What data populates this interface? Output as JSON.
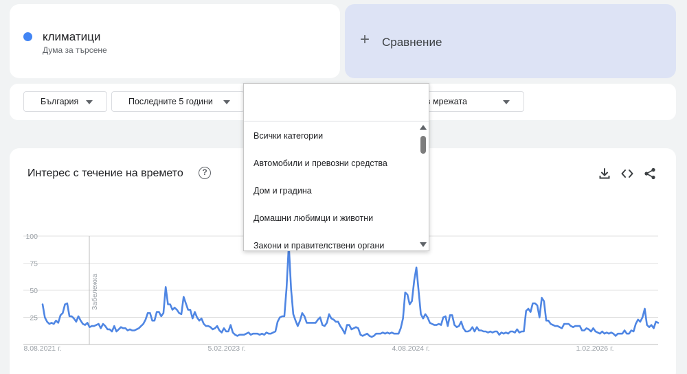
{
  "search_term": {
    "name": "климатици",
    "subtitle": "Дума за търсене",
    "color": "#4285f4"
  },
  "compare": {
    "label": "Сравнение"
  },
  "filters": {
    "region": "България",
    "period": "Последните 5 години",
    "search_type": "Търсене в мрежата"
  },
  "main": {
    "title": "Интерес с течение на времето",
    "help_icon": "help-circle-icon",
    "tools": [
      "download-icon",
      "embed-code-icon",
      "share-icon"
    ]
  },
  "category_dropdown": {
    "search_value": "",
    "items": [
      "Всички категории",
      "Автомобили и превозни средства",
      "Дом и градина",
      "Домашни любимци и животни",
      "Закони и правителствени органи"
    ]
  },
  "chart_data": {
    "type": "line",
    "ylim": [
      0,
      100
    ],
    "yticks": [
      "100",
      "75",
      "50",
      "25"
    ],
    "xtick_labels": [
      "8.08.2021 г.",
      "5.02.2023 г.",
      "4.08.2024 г.",
      "1.02.2026 г."
    ],
    "note_label": "Забележка",
    "series": [
      {
        "color": "#4f86e3",
        "values": [
          37,
          25,
          21,
          19,
          20,
          19,
          22,
          20,
          27,
          29,
          37,
          38,
          26,
          26,
          24,
          21,
          26,
          22,
          19,
          18,
          20,
          16,
          17,
          17,
          18,
          19,
          15,
          19,
          17,
          14,
          14,
          12,
          17,
          12,
          14,
          16,
          15,
          15,
          13,
          14,
          13,
          13,
          14,
          15,
          17,
          19,
          23,
          29,
          29,
          22,
          22,
          30,
          30,
          26,
          29,
          53,
          37,
          37,
          32,
          34,
          32,
          29,
          28,
          44,
          38,
          32,
          32,
          24,
          30,
          25,
          22,
          24,
          19,
          17,
          17,
          16,
          14,
          15,
          17,
          13,
          11,
          15,
          12,
          12,
          18,
          11,
          9,
          8,
          9,
          9,
          9,
          10,
          11,
          9,
          10,
          10,
          10,
          9,
          10,
          9,
          11,
          10,
          10,
          11,
          12,
          21,
          25,
          26,
          26,
          52,
          92,
          51,
          28,
          22,
          17,
          22,
          29,
          26,
          20,
          20,
          20,
          20,
          20,
          23,
          25,
          18,
          17,
          20,
          28,
          24,
          23,
          21,
          21,
          17,
          14,
          10,
          18,
          18,
          14,
          15,
          16,
          15,
          9,
          8,
          9,
          10,
          8,
          7,
          8,
          10,
          10,
          10,
          11,
          10,
          11,
          10,
          11,
          10,
          10,
          10,
          15,
          24,
          48,
          46,
          37,
          40,
          59,
          71,
          49,
          28,
          24,
          28,
          25,
          20,
          19,
          18,
          18,
          19,
          18,
          25,
          26,
          17,
          27,
          27,
          18,
          16,
          17,
          21,
          15,
          12,
          12,
          13,
          16,
          12,
          16,
          13,
          13,
          12,
          12,
          11,
          12,
          11,
          12,
          12,
          9,
          11,
          10,
          11,
          10,
          12,
          12,
          11,
          14,
          11,
          12,
          12,
          31,
          33,
          30,
          38,
          38,
          36,
          25,
          43,
          40,
          22,
          22,
          19,
          18,
          17,
          17,
          16,
          15,
          19,
          19,
          19,
          17,
          16,
          17,
          17,
          17,
          13,
          13,
          15,
          14,
          12,
          15,
          12,
          11,
          10,
          12,
          10,
          11,
          10,
          11,
          10,
          8,
          10,
          10,
          10,
          13,
          10,
          10,
          13,
          12,
          19,
          23,
          21,
          25,
          33,
          18,
          16,
          18,
          15,
          21,
          20
        ]
      }
    ]
  }
}
